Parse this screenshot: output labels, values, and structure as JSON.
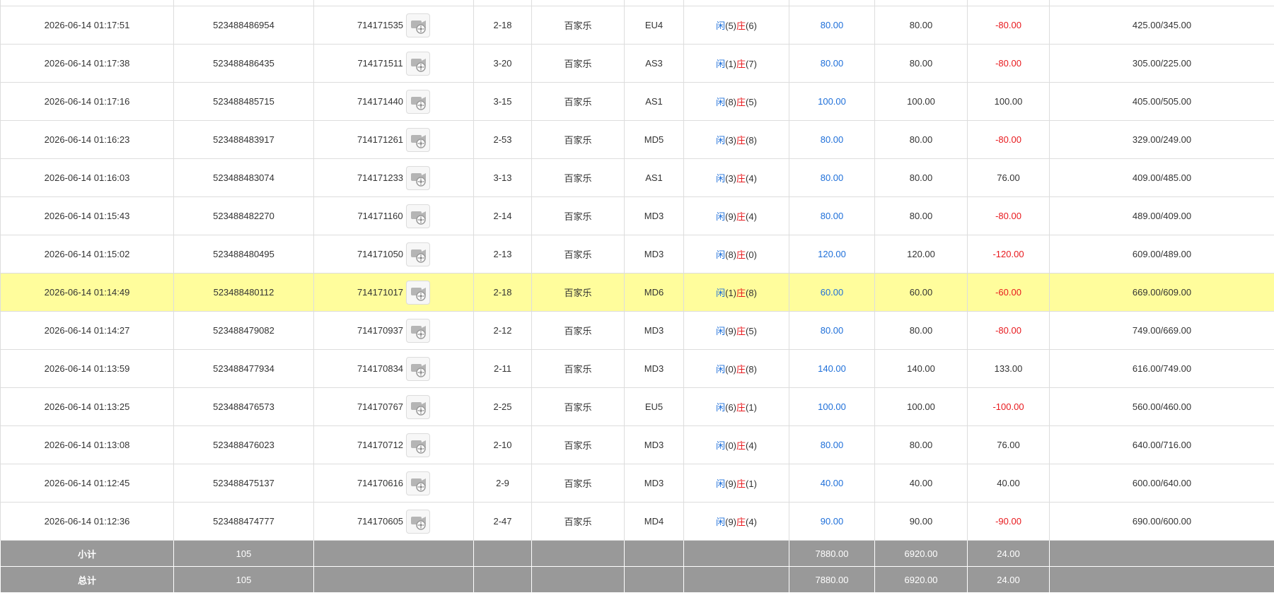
{
  "rows": [
    {
      "time": "2026-06-14 01:17:51",
      "bet_id": "523488486954",
      "game_id": "714171535",
      "shoe": "2-18",
      "game": "百家乐",
      "table": "EU4",
      "player_label": "闲",
      "player_val": "(5)",
      "banker_label": "庄",
      "banker_val": "(6)",
      "bet": "80.00",
      "valid": "80.00",
      "win": "-80.00",
      "win_negative": true,
      "balance": "425.00/345.00",
      "highlight": false
    },
    {
      "time": "2026-06-14 01:17:38",
      "bet_id": "523488486435",
      "game_id": "714171511",
      "shoe": "3-20",
      "game": "百家乐",
      "table": "AS3",
      "player_label": "闲",
      "player_val": "(1)",
      "banker_label": "庄",
      "banker_val": "(7)",
      "bet": "80.00",
      "valid": "80.00",
      "win": "-80.00",
      "win_negative": true,
      "balance": "305.00/225.00",
      "highlight": false
    },
    {
      "time": "2026-06-14 01:17:16",
      "bet_id": "523488485715",
      "game_id": "714171440",
      "shoe": "3-15",
      "game": "百家乐",
      "table": "AS1",
      "player_label": "闲",
      "player_val": "(8)",
      "banker_label": "庄",
      "banker_val": "(5)",
      "bet": "100.00",
      "valid": "100.00",
      "win": "100.00",
      "win_negative": false,
      "balance": "405.00/505.00",
      "highlight": false
    },
    {
      "time": "2026-06-14 01:16:23",
      "bet_id": "523488483917",
      "game_id": "714171261",
      "shoe": "2-53",
      "game": "百家乐",
      "table": "MD5",
      "player_label": "闲",
      "player_val": "(3)",
      "banker_label": "庄",
      "banker_val": "(8)",
      "bet": "80.00",
      "valid": "80.00",
      "win": "-80.00",
      "win_negative": true,
      "balance": "329.00/249.00",
      "highlight": false
    },
    {
      "time": "2026-06-14 01:16:03",
      "bet_id": "523488483074",
      "game_id": "714171233",
      "shoe": "3-13",
      "game": "百家乐",
      "table": "AS1",
      "player_label": "闲",
      "player_val": "(3)",
      "banker_label": "庄",
      "banker_val": "(4)",
      "bet": "80.00",
      "valid": "80.00",
      "win": "76.00",
      "win_negative": false,
      "balance": "409.00/485.00",
      "highlight": false
    },
    {
      "time": "2026-06-14 01:15:43",
      "bet_id": "523488482270",
      "game_id": "714171160",
      "shoe": "2-14",
      "game": "百家乐",
      "table": "MD3",
      "player_label": "闲",
      "player_val": "(9)",
      "banker_label": "庄",
      "banker_val": "(4)",
      "bet": "80.00",
      "valid": "80.00",
      "win": "-80.00",
      "win_negative": true,
      "balance": "489.00/409.00",
      "highlight": false
    },
    {
      "time": "2026-06-14 01:15:02",
      "bet_id": "523488480495",
      "game_id": "714171050",
      "shoe": "2-13",
      "game": "百家乐",
      "table": "MD3",
      "player_label": "闲",
      "player_val": "(8)",
      "banker_label": "庄",
      "banker_val": "(0)",
      "bet": "120.00",
      "valid": "120.00",
      "win": "-120.00",
      "win_negative": true,
      "balance": "609.00/489.00",
      "highlight": false
    },
    {
      "time": "2026-06-14 01:14:49",
      "bet_id": "523488480112",
      "game_id": "714171017",
      "shoe": "2-18",
      "game": "百家乐",
      "table": "MD6",
      "player_label": "闲",
      "player_val": "(1)",
      "banker_label": "庄",
      "banker_val": "(8)",
      "bet": "60.00",
      "valid": "60.00",
      "win": "-60.00",
      "win_negative": true,
      "balance": "669.00/609.00",
      "highlight": true
    },
    {
      "time": "2026-06-14 01:14:27",
      "bet_id": "523488479082",
      "game_id": "714170937",
      "shoe": "2-12",
      "game": "百家乐",
      "table": "MD3",
      "player_label": "闲",
      "player_val": "(9)",
      "banker_label": "庄",
      "banker_val": "(5)",
      "bet": "80.00",
      "valid": "80.00",
      "win": "-80.00",
      "win_negative": true,
      "balance": "749.00/669.00",
      "highlight": false
    },
    {
      "time": "2026-06-14 01:13:59",
      "bet_id": "523488477934",
      "game_id": "714170834",
      "shoe": "2-11",
      "game": "百家乐",
      "table": "MD3",
      "player_label": "闲",
      "player_val": "(0)",
      "banker_label": "庄",
      "banker_val": "(8)",
      "bet": "140.00",
      "valid": "140.00",
      "win": "133.00",
      "win_negative": false,
      "balance": "616.00/749.00",
      "highlight": false
    },
    {
      "time": "2026-06-14 01:13:25",
      "bet_id": "523488476573",
      "game_id": "714170767",
      "shoe": "2-25",
      "game": "百家乐",
      "table": "EU5",
      "player_label": "闲",
      "player_val": "(6)",
      "banker_label": "庄",
      "banker_val": "(1)",
      "bet": "100.00",
      "valid": "100.00",
      "win": "-100.00",
      "win_negative": true,
      "balance": "560.00/460.00",
      "highlight": false
    },
    {
      "time": "2026-06-14 01:13:08",
      "bet_id": "523488476023",
      "game_id": "714170712",
      "shoe": "2-10",
      "game": "百家乐",
      "table": "MD3",
      "player_label": "闲",
      "player_val": "(0)",
      "banker_label": "庄",
      "banker_val": "(4)",
      "bet": "80.00",
      "valid": "80.00",
      "win": "76.00",
      "win_negative": false,
      "balance": "640.00/716.00",
      "highlight": false
    },
    {
      "time": "2026-06-14 01:12:45",
      "bet_id": "523488475137",
      "game_id": "714170616",
      "shoe": "2-9",
      "game": "百家乐",
      "table": "MD3",
      "player_label": "闲",
      "player_val": "(9)",
      "banker_label": "庄",
      "banker_val": "(1)",
      "bet": "40.00",
      "valid": "40.00",
      "win": "40.00",
      "win_negative": false,
      "balance": "600.00/640.00",
      "highlight": false
    },
    {
      "time": "2026-06-14 01:12:36",
      "bet_id": "523488474777",
      "game_id": "714170605",
      "shoe": "2-47",
      "game": "百家乐",
      "table": "MD4",
      "player_label": "闲",
      "player_val": "(9)",
      "banker_label": "庄",
      "banker_val": "(4)",
      "bet": "90.00",
      "valid": "90.00",
      "win": "-90.00",
      "win_negative": true,
      "balance": "690.00/600.00",
      "highlight": false
    }
  ],
  "subtotal": {
    "label": "小计",
    "count": "105",
    "bet": "7880.00",
    "valid": "6920.00",
    "win": "24.00"
  },
  "total": {
    "label": "总计",
    "count": "105",
    "bet": "7880.00",
    "valid": "6920.00",
    "win": "24.00"
  },
  "icons": {
    "video": "video-replay-icon"
  },
  "colors": {
    "blue": "#1e6fd9",
    "red": "#e8191d",
    "highlight": "#fffd9c",
    "summary_bg": "#999999"
  }
}
